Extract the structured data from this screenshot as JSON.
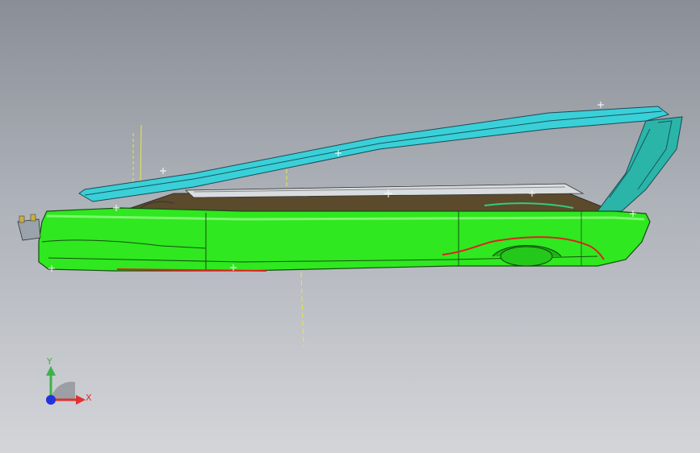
{
  "view": {
    "background_top": "#8a8e95",
    "background_bottom": "#d3d5d9"
  },
  "model": {
    "body_color": "#2fe81f",
    "roof_rail_color": "#3ad0d8",
    "accent_color": "#e02020",
    "construction_line_color": "#e8e84a"
  },
  "triad": {
    "y_label": "Y",
    "x_label": "X",
    "y_color": "#3bb34a",
    "x_color": "#e03030",
    "z_color": "#2233dd"
  }
}
